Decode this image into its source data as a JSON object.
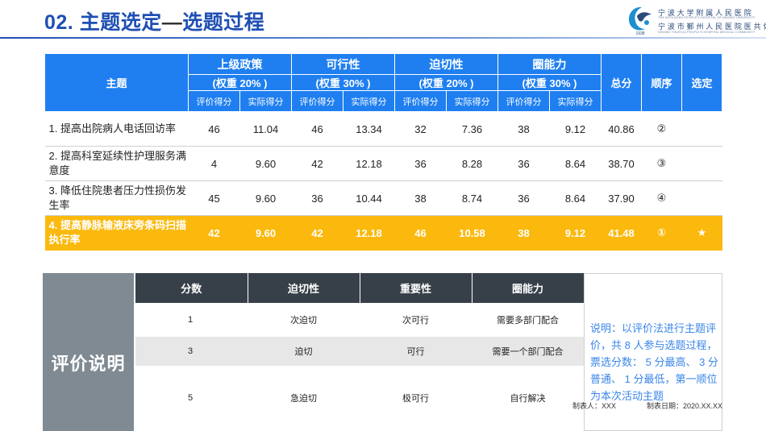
{
  "header": {
    "title_main": "02. 主题选定",
    "title_dash": "—",
    "title_rest": "选题过程"
  },
  "logo": {
    "line1": "宁 波 大 学  附 属 人 民 医 院",
    "line1_sub": "THE AFFILIATED PEOPLE'S HOSPITAL OF NINGBO UNIVERSITY",
    "line2": "宁 波 市 鄞 州 人 民 医 院  医 共 体",
    "line2_sub": "NINGBO YINZHOU PEOPLE'S HOSPITAL MEDICAL COMMUNITY",
    "emblem_text": "1938"
  },
  "main_table": {
    "headers": {
      "topic": "主题",
      "policy": "上级政策",
      "policy_weight": "(权重 20% )",
      "feasibility": "可行性",
      "feasibility_weight": "(权重 30% )",
      "urgency": "迫切性",
      "urgency_weight": "(权重 20% )",
      "capability": "圈能力",
      "capability_weight": "(权重 30% )",
      "total": "总分",
      "order": "顺序",
      "select": "选定",
      "eval_score": "评价得分",
      "actual_score": "实际得分"
    },
    "rows": [
      {
        "topic": "1. 提高出院病人电话回访率",
        "v": [
          "46",
          "11.04",
          "46",
          "13.34",
          "32",
          "7.36",
          "38",
          "9.12",
          "40.86",
          "②",
          ""
        ]
      },
      {
        "topic": "2. 提高科室延续性护理服务满意度",
        "v": [
          "4",
          "9.60",
          "42",
          "12.18",
          "36",
          "8.28",
          "36",
          "8.64",
          "38.70",
          "③",
          ""
        ]
      },
      {
        "topic": "3. 降低住院患者压力性损伤发生率",
        "v": [
          "45",
          "9.60",
          "36",
          "10.44",
          "38",
          "8.74",
          "36",
          "8.64",
          "37.90",
          "④",
          ""
        ]
      },
      {
        "topic": "4. 提高静脉输液床旁条码扫描执行率",
        "v": [
          "42",
          "9.60",
          "42",
          "12.18",
          "46",
          "10.58",
          "38",
          "9.12",
          "41.48",
          "①",
          "★"
        ]
      }
    ]
  },
  "eval_section": {
    "label": "评价说明",
    "headers": [
      "分数",
      "迫切性",
      "重要性",
      "圈能力"
    ],
    "rows": [
      [
        "1",
        "次迫切",
        "次可行",
        "需要多部门配合"
      ],
      [
        "3",
        "迫切",
        "可行",
        "需要一个部门配合"
      ],
      [
        "5",
        "急迫切",
        "极可行",
        "自行解决"
      ]
    ],
    "note": "说明：以评价法进行主题评价，共 8 人参与选题过程，票选分数： 5 分最高、 3 分普通、 1 分最低，第一顺位为本次活动主题",
    "maker": "制表人：XXX",
    "date": "制表日期：2020.XX.XX"
  },
  "colors": {
    "title_blue": "#1f4fb4",
    "header_blue": "#1f7ff0",
    "highlight_yellow": "#fbb90e",
    "eval_dark": "#374048",
    "eval_label_gray": "#7f8a93",
    "note_blue": "#3a86e8"
  }
}
